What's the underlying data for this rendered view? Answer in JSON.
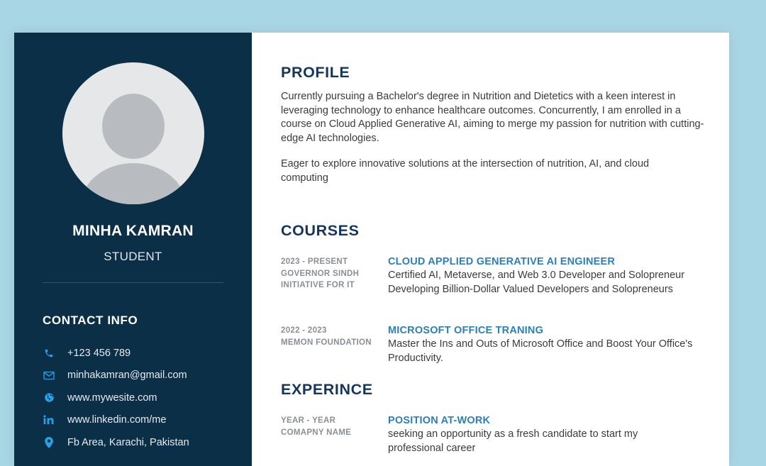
{
  "sidebar": {
    "name": "MINHA KAMRAN",
    "role": "STUDENT",
    "contact_title": "CONTACT INFO",
    "contacts": [
      {
        "icon": "phone-icon",
        "text": "+123 456 789"
      },
      {
        "icon": "email-icon",
        "text": "minhakamran@gmail.com"
      },
      {
        "icon": "globe-icon",
        "text": "www.mywesite.com"
      },
      {
        "icon": "linkedin-icon",
        "text": "www.linkedin.com/me"
      },
      {
        "icon": "location-pin-icon",
        "text": "Fb Area, Karachi, Pakistan"
      }
    ]
  },
  "profile": {
    "title": "PROFILE",
    "paragraph1": "Currently pursuing a Bachelor's degree in Nutrition and Dietetics with a keen interest in leveraging technology to enhance healthcare outcomes. Concurrently, I am enrolled in a course on Cloud Applied Generative AI, aiming to merge my passion for nutrition with cutting-edge AI technologies.",
    "paragraph2": "Eager to explore innovative solutions at the intersection of nutrition, AI, and cloud computing"
  },
  "courses": {
    "title": "COURSES",
    "items": [
      {
        "date": "2023 - PRESENT",
        "org": "GOVERNOR SINDH INITIATIVE FOR IT",
        "title": "CLOUD APPLIED GENERATIVE AI ENGINEER",
        "desc": "Certified AI, Metaverse, and Web 3.0 Developer and Solopreneur Developing Billion-Dollar Valued Developers and Solopreneurs"
      },
      {
        "date": "2022 - 2023",
        "org": "MEMON FOUNDATION",
        "title": "MICROSOFT OFFICE TRANING",
        "desc": "Master the Ins and Outs of Microsoft Office and Boost Your Office's Productivity."
      }
    ]
  },
  "experience": {
    "title": "EXPERINCE",
    "items": [
      {
        "date": "YEAR - YEAR",
        "org": "COMAPNY NAME",
        "title": "POSITION AT-WORK",
        "desc": "seeking an opportunity as a fresh candidate to start my professional career"
      }
    ]
  },
  "colors": {
    "sidebar_bg": "#0b2f47",
    "heading": "#16365a",
    "accent": "#2d7fb5",
    "page_bg": "#a9d6e5"
  }
}
